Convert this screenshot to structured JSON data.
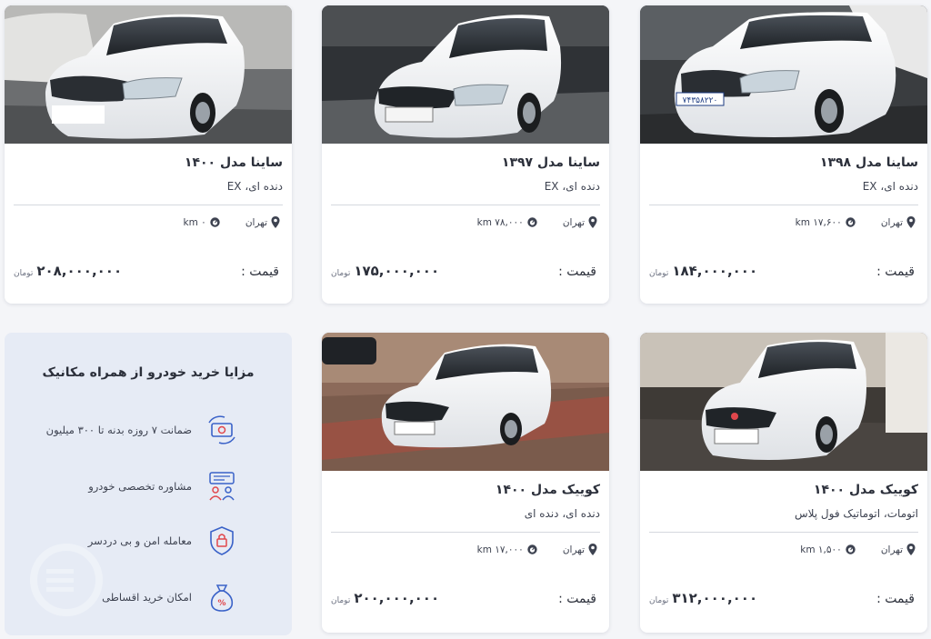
{
  "currency": "تومان",
  "price_label": "قیمت :",
  "colors": {
    "accent": "#3a62c8",
    "accent_red": "#e0474c",
    "card_bg": "#ffffff",
    "benefits_bg": "#e6ebf5"
  },
  "cards": [
    {
      "title": "ساینا مدل ۱۳۹۸",
      "subtitle": "دنده ای، EX",
      "city": "تهران",
      "mileage": "۱۷,۶۰۰ km",
      "price": "۱۸۴,۰۰۰,۰۰۰"
    },
    {
      "title": "ساینا مدل ۱۳۹۷",
      "subtitle": "دنده ای، EX",
      "city": "تهران",
      "mileage": "۷۸,۰۰۰ km",
      "price": "۱۷۵,۰۰۰,۰۰۰"
    },
    {
      "title": "ساینا مدل ۱۴۰۰",
      "subtitle": "دنده ای، EX",
      "city": "تهران",
      "mileage": "۰ km",
      "price": "۲۰۸,۰۰۰,۰۰۰"
    },
    {
      "title": "کوییک مدل ۱۴۰۰",
      "subtitle": "اتومات، اتوماتیک فول پلاس",
      "city": "تهران",
      "mileage": "۱,۵۰۰ km",
      "price": "۳۱۲,۰۰۰,۰۰۰"
    },
    {
      "title": "کوییک مدل ۱۴۰۰",
      "subtitle": "دنده ای، دنده ای",
      "city": "تهران",
      "mileage": "۱۷,۰۰۰ km",
      "price": "۲۰۰,۰۰۰,۰۰۰"
    }
  ],
  "benefits": {
    "title": "مزایا خرید خودرو از همراه مکانیک",
    "items": [
      {
        "label": "ضمانت ۷ روزه بدنه تا ۳۰۰ میلیون",
        "icon": "cash-refresh-icon"
      },
      {
        "label": "مشاوره تخصصی خودرو",
        "icon": "consultation-icon"
      },
      {
        "label": "معامله امن و بی دردسر",
        "icon": "shield-lock-icon"
      },
      {
        "label": "امکان خرید اقساطی",
        "icon": "installment-bag-icon"
      }
    ]
  }
}
